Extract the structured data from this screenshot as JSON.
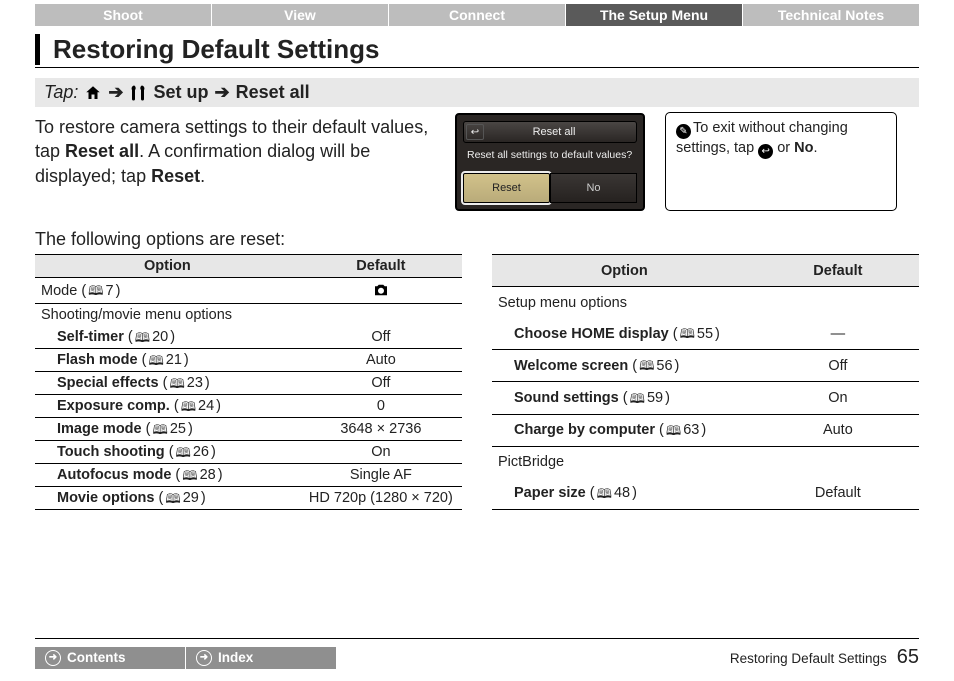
{
  "tabs": {
    "shoot": "Shoot",
    "view": "View",
    "connect": "Connect",
    "setup": "The Setup Menu",
    "tech": "Technical Notes"
  },
  "title": "Restoring Default Settings",
  "tap": {
    "label": "Tap:",
    "setup": "Set up",
    "reset": "Reset all"
  },
  "body": {
    "p1a": "To restore camera settings to their default values, tap ",
    "p1b": "Reset all",
    "p1c": ". A confirmation dialog will be displayed; tap ",
    "p1d": "Reset",
    "p1e": "."
  },
  "device": {
    "title": "Reset all",
    "msg": "Reset all settings to default values?",
    "reset": "Reset",
    "no": "No"
  },
  "note": {
    "t1": "To exit without changing settings, tap ",
    "t2": " or ",
    "no": "No",
    "t3": "."
  },
  "subhead": "The following options are reset:",
  "th_option": "Option",
  "th_default": "Default",
  "left": {
    "mode_label": "Mode",
    "mode_pg": "7",
    "group1": "Shooting/movie menu options",
    "r": [
      {
        "label": "Self-timer",
        "pg": "20",
        "def": "Off"
      },
      {
        "label": "Flash mode",
        "pg": "21",
        "def": "Auto"
      },
      {
        "label": "Special effects",
        "pg": "23",
        "def": "Off"
      },
      {
        "label": "Exposure comp.",
        "pg": "24",
        "def": "0"
      },
      {
        "label": "Image mode",
        "pg": "25",
        "def": "3648 × 2736"
      },
      {
        "label": "Touch shooting",
        "pg": "26",
        "def": "On"
      },
      {
        "label": "Autofocus mode",
        "pg": "28",
        "def": "Single AF"
      },
      {
        "label": "Movie options",
        "pg": "29",
        "def": "HD 720p (1280 × 720)"
      }
    ]
  },
  "right": {
    "group1": "Setup menu options",
    "r": [
      {
        "label": "Choose HOME display",
        "pg": "55",
        "def": "—"
      },
      {
        "label": "Welcome screen",
        "pg": "56",
        "def": "Off"
      },
      {
        "label": "Sound settings",
        "pg": "59",
        "def": "On"
      },
      {
        "label": "Charge by computer",
        "pg": "63",
        "def": "Auto"
      }
    ],
    "group2": "PictBridge",
    "r2": [
      {
        "label": "Paper size",
        "pg": "48",
        "def": "Default"
      }
    ]
  },
  "footer": {
    "contents": "Contents",
    "index": "Index",
    "section": "Restoring Default Settings",
    "page": "65"
  }
}
